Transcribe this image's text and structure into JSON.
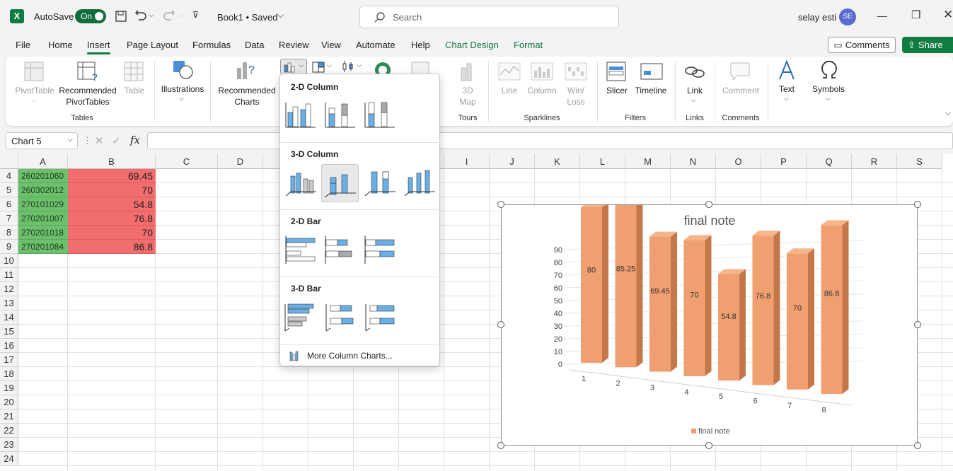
{
  "titlebar": {
    "autosave_label": "AutoSave",
    "autosave_state": "On",
    "doc_title": "Book1 • Saved",
    "search_placeholder": "Search",
    "user_name": "selay esti",
    "user_initials": "SE"
  },
  "tabs": [
    "File",
    "Home",
    "Insert",
    "Page Layout",
    "Formulas",
    "Data",
    "Review",
    "View",
    "Automate",
    "Help",
    "Chart Design",
    "Format"
  ],
  "active_tab": "Insert",
  "actions": {
    "comments": "Comments",
    "share": "Share"
  },
  "ribbon": {
    "pivottable": "PivotTable",
    "recommended_pivot_1": "Recommended",
    "recommended_pivot_2": "PivotTables",
    "table": "Table",
    "illustrations": "Illustrations",
    "recommended_charts_1": "Recommended",
    "recommended_charts_2": "Charts",
    "map3d_1": "3D",
    "map3d_2": "Map",
    "line": "Line",
    "column": "Column",
    "winloss_1": "Win/",
    "winloss_2": "Loss",
    "slicer": "Slicer",
    "timeline": "Timeline",
    "link": "Link",
    "comment": "Comment",
    "text": "Text",
    "symbols": "Symbols",
    "groups": {
      "tables": "Tables",
      "tours": "Tours",
      "sparklines": "Sparklines",
      "filters": "Filters",
      "links": "Links",
      "comments": "Comments"
    }
  },
  "formula_bar": {
    "name_box": "Chart 5",
    "fx": "fx",
    "formula": ""
  },
  "columns": [
    "A",
    "B",
    "C",
    "D",
    "E",
    "F",
    "G",
    "H",
    "I",
    "J",
    "K",
    "L",
    "M",
    "N",
    "O",
    "P",
    "Q",
    "R",
    "S"
  ],
  "rows": [
    {
      "num": "4",
      "a": "260201060",
      "b": "69.45"
    },
    {
      "num": "5",
      "a": "260302012",
      "b": "70"
    },
    {
      "num": "6",
      "a": "270101029",
      "b": "54.8"
    },
    {
      "num": "7",
      "a": "270201007",
      "b": "76.8"
    },
    {
      "num": "8",
      "a": "270201018",
      "b": "70"
    },
    {
      "num": "9",
      "a": "270201084",
      "b": "86.8"
    },
    {
      "num": "10"
    },
    {
      "num": "11"
    },
    {
      "num": "12"
    },
    {
      "num": "13"
    },
    {
      "num": "14"
    },
    {
      "num": "15"
    },
    {
      "num": "16"
    },
    {
      "num": "17"
    },
    {
      "num": "18"
    },
    {
      "num": "19"
    },
    {
      "num": "20"
    },
    {
      "num": "21"
    },
    {
      "num": "22"
    },
    {
      "num": "23"
    },
    {
      "num": "24"
    }
  ],
  "dropdown": {
    "col2d": "2-D Column",
    "col3d": "3-D Column",
    "bar2d": "2-D Bar",
    "bar3d": "3-D Bar",
    "more": "More Column Charts..."
  },
  "chart_data": {
    "type": "bar",
    "title": "final note",
    "categories": [
      "1",
      "2",
      "3",
      "4",
      "5",
      "6",
      "7",
      "8"
    ],
    "series": [
      {
        "name": "final note",
        "values": [
          80,
          85.25,
          69.45,
          70,
          54.8,
          76.8,
          70,
          86.8
        ]
      }
    ],
    "ylim": [
      0,
      90
    ],
    "yticks": [
      "0",
      "10",
      "20",
      "30",
      "40",
      "50",
      "60",
      "70",
      "80",
      "90"
    ],
    "data_labels": [
      "80",
      "85.25",
      "69.45",
      "70",
      "54.8",
      "76.8",
      "70",
      "86.8"
    ],
    "bar_color": "#f0a070",
    "legend": "bottom",
    "grid": true
  }
}
